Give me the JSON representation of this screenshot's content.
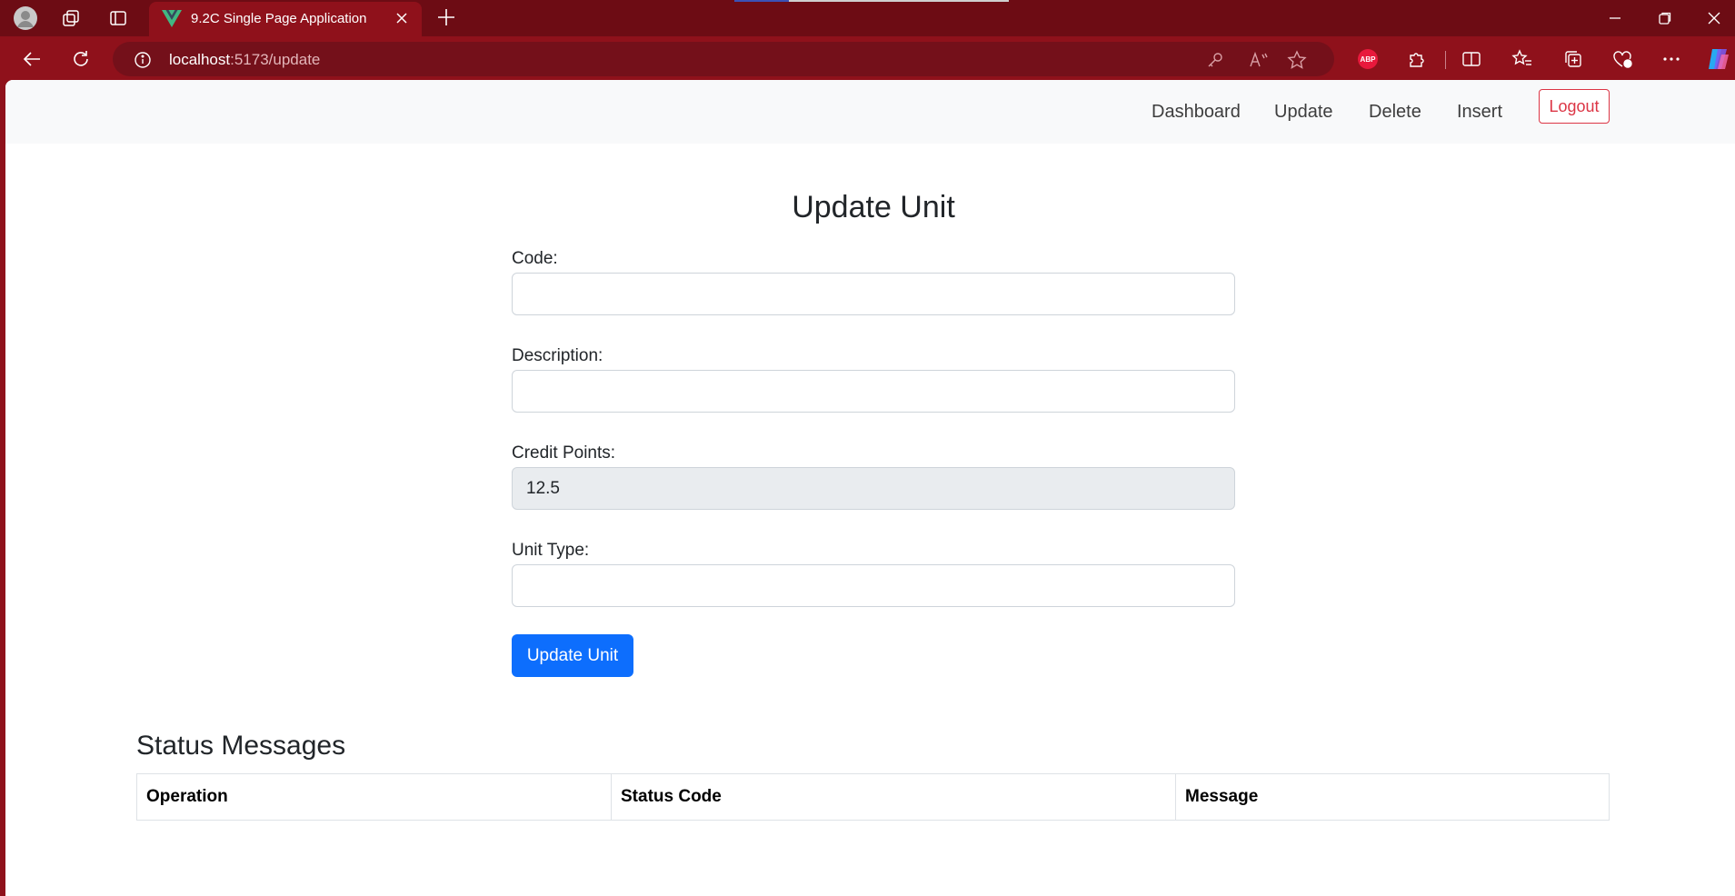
{
  "browser": {
    "tab_title": "9.2C Single Page Application",
    "url_host": "localhost",
    "url_path": ":5173/update",
    "abp_label": "ABP"
  },
  "navbar": {
    "links": [
      "Dashboard",
      "Update",
      "Delete",
      "Insert"
    ],
    "logout_label": "Logout"
  },
  "form": {
    "title": "Update Unit",
    "code_label": "Code:",
    "code_value": "",
    "description_label": "Description:",
    "description_value": "",
    "credit_points_label": "Credit Points:",
    "credit_points_value": "12.5",
    "unit_type_label": "Unit Type:",
    "unit_type_value": "",
    "submit_label": "Update Unit"
  },
  "status": {
    "title": "Status Messages",
    "columns": [
      "Operation",
      "Status Code",
      "Message"
    ]
  },
  "colors": {
    "primary": "#0d6efd",
    "danger": "#dc3545",
    "browser_frame": "#8f111b"
  }
}
